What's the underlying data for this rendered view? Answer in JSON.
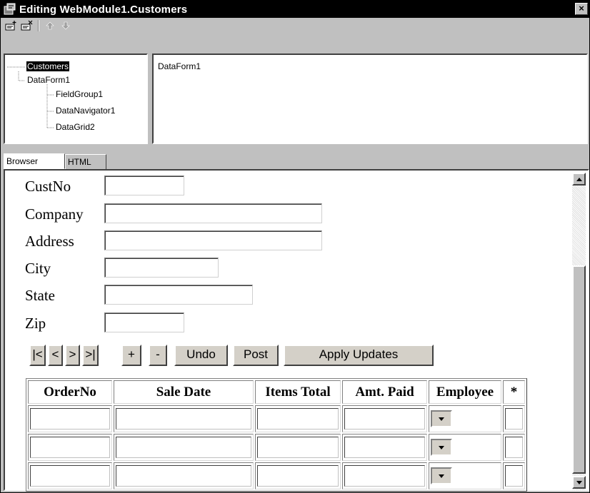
{
  "window": {
    "title": "Editing WebModule1.Customers",
    "close_label": "×"
  },
  "toolbar": {
    "buttons": [
      {
        "icon": "new-item-icon"
      },
      {
        "icon": "delete-item-icon"
      },
      {
        "icon": "move-up-icon"
      },
      {
        "icon": "move-down-icon"
      }
    ]
  },
  "tree": {
    "items": [
      {
        "label": "Customers",
        "selected": true
      },
      {
        "label": "DataForm1"
      },
      {
        "label": "FieldGroup1"
      },
      {
        "label": "DataNavigator1"
      },
      {
        "label": "DataGrid2"
      }
    ]
  },
  "props": {
    "text": "DataForm1"
  },
  "tabs": [
    {
      "label": "Browser",
      "active": true
    },
    {
      "label": "HTML",
      "active": false
    }
  ],
  "form": {
    "fields": [
      {
        "label": "CustNo",
        "value": ""
      },
      {
        "label": "Company",
        "value": ""
      },
      {
        "label": "Address",
        "value": ""
      },
      {
        "label": "City",
        "value": ""
      },
      {
        "label": "State",
        "value": ""
      },
      {
        "label": "Zip",
        "value": ""
      }
    ]
  },
  "navigator": {
    "buttons": [
      {
        "label": "|<"
      },
      {
        "label": "<"
      },
      {
        "label": ">"
      },
      {
        "label": ">|"
      },
      {
        "label": "+"
      },
      {
        "label": "-"
      },
      {
        "label": "Undo"
      },
      {
        "label": "Post"
      },
      {
        "label": "Apply Updates"
      }
    ]
  },
  "grid": {
    "columns": [
      "OrderNo",
      "Sale Date",
      "Items Total",
      "Amt. Paid",
      "Employee",
      "*"
    ],
    "rows": [
      [
        "",
        "",
        "",
        "",
        "",
        ""
      ],
      [
        "",
        "",
        "",
        "",
        "",
        ""
      ],
      [
        "",
        "",
        "",
        "",
        "",
        ""
      ]
    ]
  },
  "colors": {
    "title_bg": "#000000",
    "face": "#c0c0c0",
    "selection": "#000000"
  }
}
